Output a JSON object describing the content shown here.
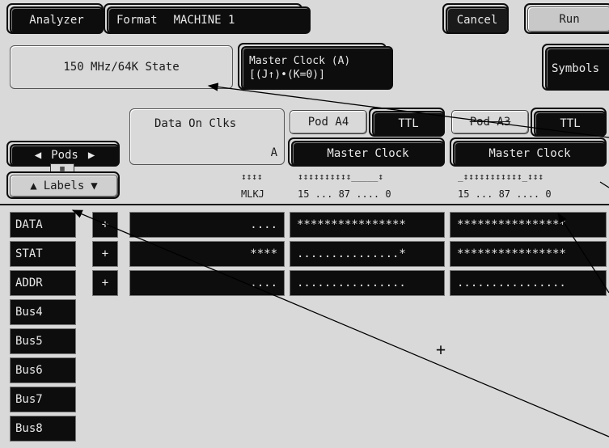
{
  "topbar": {
    "analyzer": "Analyzer",
    "format": "Format",
    "machine": "MACHINE 1",
    "cancel": "Cancel",
    "run": "Run"
  },
  "mode_panel": {
    "label": "150 MHz/64K State"
  },
  "master_clock": {
    "line1": "Master Clock (A)",
    "line2": "[(J↑)•(K=0)]"
  },
  "symbols": "Symbols",
  "data_on_clks": {
    "title": "Data On Clks",
    "value": "A"
  },
  "pods_button": "Pods",
  "labels_button": "Labels",
  "clk_header": {
    "arrows": "↕↕↕↕",
    "letters": "MLKJ"
  },
  "pod_a4": {
    "name": "Pod A4",
    "threshold": "TTL",
    "clock": "Master Clock",
    "activity": "↕↕↕↕↕↕↕↕↕↕_____↕",
    "bits": "15 ... 87 .... 0"
  },
  "pod_a3": {
    "name": "Pod A3",
    "threshold": "TTL",
    "clock": "Master Clock",
    "activity": "_↕↕↕↕↕↕↕↕↕↕↕_↕↕↕",
    "bits": "15 ... 87 .... 0"
  },
  "rows": [
    {
      "label": "DATA",
      "plus": "+",
      "clk": "....",
      "a4": "****************",
      "a3": "****************"
    },
    {
      "label": "STAT",
      "plus": "+",
      "clk": "****",
      "a4": "...............*",
      "a3": "****************"
    },
    {
      "label": "ADDR",
      "plus": "+",
      "clk": "....",
      "a4": "................",
      "a3": "................"
    },
    {
      "label": "Bus4"
    },
    {
      "label": "Bus5"
    },
    {
      "label": "Bus6"
    },
    {
      "label": "Bus7"
    },
    {
      "label": "Bus8"
    }
  ],
  "cursor": "+"
}
